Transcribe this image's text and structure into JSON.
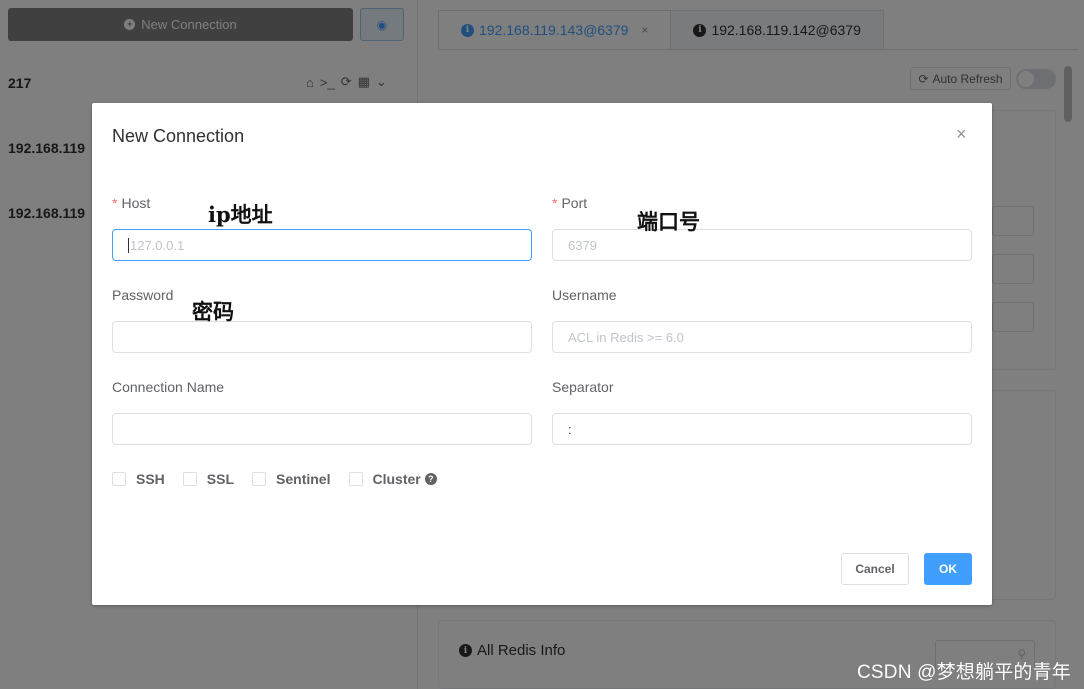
{
  "sidebar": {
    "new_connection_label": "New Connection",
    "connections": [
      {
        "label": "217"
      },
      {
        "label": "192.168.119"
      },
      {
        "label": "192.168.119"
      }
    ]
  },
  "tabs": [
    {
      "label": "192.168.119.143@6379",
      "active": true,
      "close": "×"
    },
    {
      "label": "192.168.119.142@6379",
      "active": false
    }
  ],
  "toolbar": {
    "auto_refresh_label": "Auto Refresh"
  },
  "cards": {
    "all_redis_info_title": "All Redis Info"
  },
  "dialog": {
    "title": "New Connection",
    "close": "×",
    "fields": {
      "host": {
        "label": "Host",
        "placeholder": "127.0.0.1",
        "required": true
      },
      "port": {
        "label": "Port",
        "placeholder": "6379",
        "required": true
      },
      "password": {
        "label": "Password",
        "value": ""
      },
      "username": {
        "label": "Username",
        "placeholder": "ACL in Redis >= 6.0"
      },
      "connection_name": {
        "label": "Connection Name",
        "value": ""
      },
      "separator": {
        "label": "Separator",
        "value": ":"
      }
    },
    "checkboxes": [
      {
        "label": "SSH",
        "checked": false
      },
      {
        "label": "SSL",
        "checked": false
      },
      {
        "label": "Sentinel",
        "checked": false
      },
      {
        "label": "Cluster",
        "checked": false
      }
    ],
    "buttons": {
      "cancel": "Cancel",
      "ok": "OK"
    }
  },
  "annotations": {
    "host": "ip地址",
    "port": "端口号",
    "password": "密码"
  },
  "watermark": "CSDN @梦想躺平的青年",
  "colors": {
    "primary": "#409eff",
    "required": "#f56c6c",
    "overlay": "rgba(0,0,0,0.5)"
  }
}
